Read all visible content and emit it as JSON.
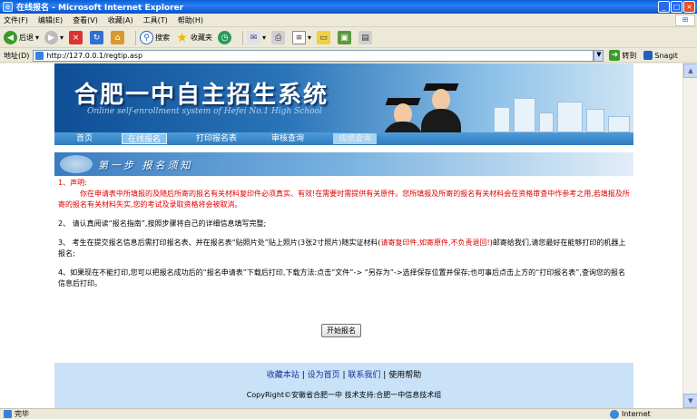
{
  "window": {
    "title": "在线报名 - Microsoft Internet Explorer"
  },
  "menu": [
    "文件(F)",
    "编辑(E)",
    "查看(V)",
    "收藏(A)",
    "工具(T)",
    "帮助(H)"
  ],
  "toolbar": {
    "back": "后退",
    "search": "搜索",
    "favorites": "收藏夹"
  },
  "address": {
    "label": "地址(D)",
    "url": "http://127.0.0.1/regtip.asp",
    "go": "转到",
    "snagit": "Snagit"
  },
  "banner": {
    "title": "合肥一中自主招生系统",
    "subtitle": "Online self-enrollment system of Hefei No.1 High School"
  },
  "nav": [
    "首页",
    "在线报名",
    "打印报名表",
    "审核查询",
    "成绩查询"
  ],
  "step": {
    "title": "第一步  报名须知"
  },
  "content": {
    "p1_head": "1、声明:",
    "p1_body": "你在申请表中所填报的及随后所寄的报名有关材料复印件必须真实、有效!在需要时需提供有关原件。您所填报及所寄的报名有关材料会在资格审查中作参考之用,若填报及所寄的报名有关材料失实,您的考试及录取资格将会被取消。",
    "p2": "2、 请认真阅读“报名指南”,按照步骤将自己的详细信息填写完整;",
    "p3_a": "3、 考生在提交报名信息后需打印报名表、并在报名表“贴照片处”贴上照片(3张2寸照片)随实证材料(",
    "p3_red": "请寄复印件,如寄原件,不负责退回!",
    "p3_b": ")邮寄给我们,请您最好在能够打印的机器上报名;",
    "p4": "4、如果现在不能打印,您可以把报名成功后的“报名申请表”下载后打印,下载方法:点击“文件”-> “另存为”->选择保存位置并保存;也可事后点击上方的“打印报名表”,查询您的报名信息后打印。",
    "start_button": "开始报名"
  },
  "footer": {
    "links": [
      "收藏本站",
      "设为首页",
      "联系我们",
      "使用帮助"
    ],
    "copyright": "CopyRight©安徽省合肥一中 技术支持:合肥一中信息技术组"
  },
  "status": {
    "left": "完毕",
    "zone": "Internet"
  }
}
